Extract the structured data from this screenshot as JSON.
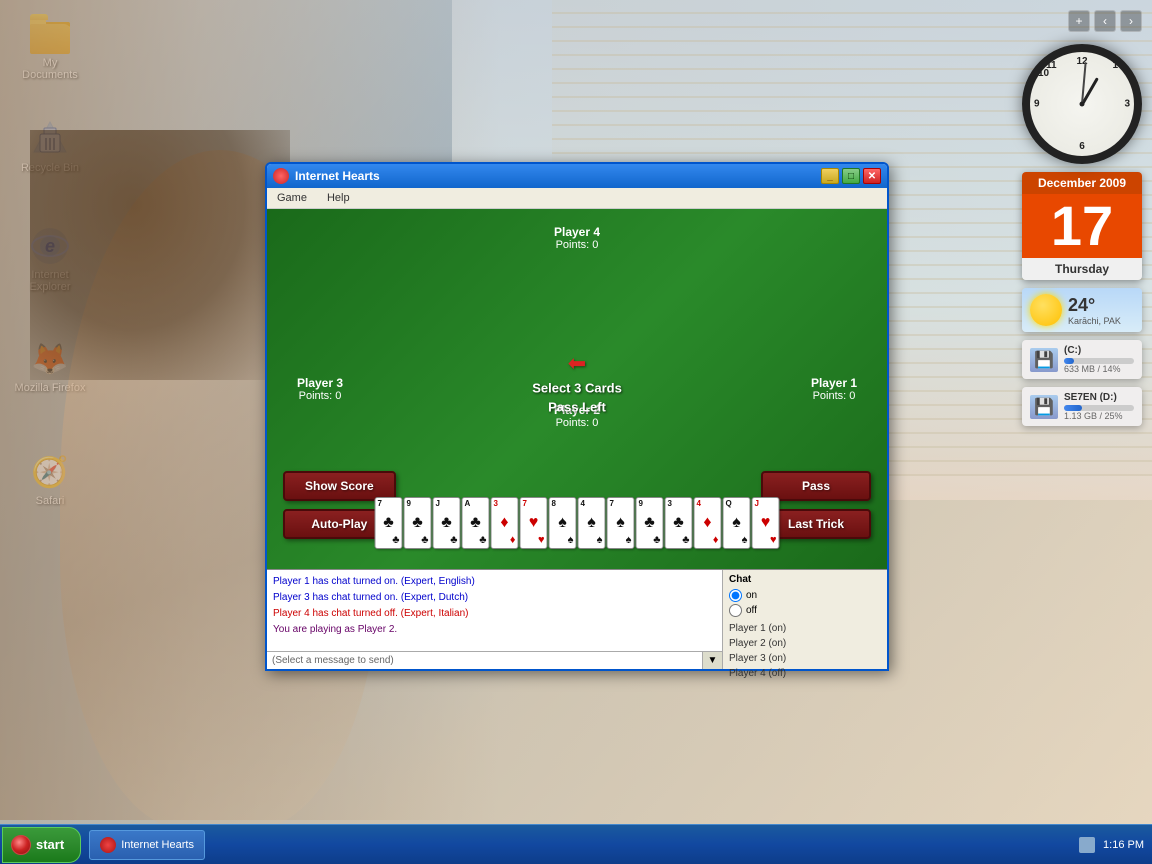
{
  "desktop": {
    "icons": [
      {
        "id": "my-documents",
        "label": "My Documents",
        "type": "folder"
      },
      {
        "id": "recycle-bin",
        "label": "Recycle Bin",
        "type": "recycle"
      },
      {
        "id": "internet-explorer",
        "label": "Internet Explorer",
        "type": "ie"
      },
      {
        "id": "mozilla-firefox",
        "label": "Mozilla Firefox",
        "type": "firefox"
      },
      {
        "id": "safari",
        "label": "Safari",
        "type": "safari"
      }
    ]
  },
  "widgets": {
    "calendar": {
      "month": "December 2009",
      "day": "17",
      "weekday": "Thursday"
    },
    "weather": {
      "temp": "24°",
      "city": "Karāchi, PAK"
    },
    "drives": [
      {
        "label": "(C:)",
        "size": "633 MB / 14%",
        "pct": 14
      },
      {
        "label": "SE7EN (D:)",
        "size": "1.13 GB / 25%",
        "pct": 25
      }
    ],
    "clock": {
      "hour_angle": 30,
      "minute_angle": 8
    }
  },
  "window": {
    "title": "Internet Hearts",
    "menu": [
      "Game",
      "Help"
    ]
  },
  "game": {
    "players": [
      {
        "id": "player4",
        "name": "Player 4",
        "points": "Points: 0"
      },
      {
        "id": "player3",
        "name": "Player 3",
        "points": "Points: 0"
      },
      {
        "id": "player1",
        "name": "Player 1",
        "points": "Points: 0"
      },
      {
        "id": "player2",
        "name": "Player 2",
        "points": "Points: 0"
      }
    ],
    "center": {
      "line1": "Select 3 Cards",
      "line2": "Pass Left"
    },
    "buttons": {
      "show_score": "Show Score",
      "auto_play": "Auto-Play",
      "pass": "Pass",
      "last_trick": "Last Trick"
    },
    "cards": [
      {
        "rank": "7",
        "suit": "♣",
        "color": "black"
      },
      {
        "rank": "9",
        "suit": "♣",
        "color": "black"
      },
      {
        "rank": "J",
        "suit": "♣",
        "color": "black"
      },
      {
        "rank": "A",
        "suit": "♣",
        "color": "black"
      },
      {
        "rank": "3",
        "suit": "♦",
        "color": "red"
      },
      {
        "rank": "7",
        "suit": "♥",
        "color": "red"
      },
      {
        "rank": "8",
        "suit": "♠",
        "color": "black"
      },
      {
        "rank": "4",
        "suit": "♠",
        "color": "black"
      },
      {
        "rank": "7",
        "suit": "♠",
        "color": "black"
      },
      {
        "rank": "9",
        "suit": "♣",
        "color": "black"
      },
      {
        "rank": "3",
        "suit": "♣",
        "color": "black"
      },
      {
        "rank": "4",
        "suit": "♦",
        "color": "red"
      },
      {
        "rank": "Q",
        "suit": "♠",
        "color": "black"
      },
      {
        "rank": "J",
        "suit": "♥",
        "color": "red"
      }
    ]
  },
  "chat": {
    "log": [
      {
        "text": "Player 1 has chat turned on.  (Expert, English)",
        "color": "blue"
      },
      {
        "text": "Player 3 has chat turned on.  (Expert, Dutch)",
        "color": "blue"
      },
      {
        "text": "Player 4 has chat turned off.  (Expert, Italian)",
        "color": "red"
      },
      {
        "text": "You are playing as Player 2.",
        "color": "purple"
      }
    ],
    "input_placeholder": "(Select a message to send)",
    "header": "Chat",
    "radio_on": "on",
    "radio_off": "off",
    "players": [
      "Player 1 (on)",
      "Player 2 (on)",
      "Player 3 (on)",
      "Player 4 (off)"
    ]
  },
  "taskbar": {
    "start_label": "start",
    "app_label": "Internet Hearts",
    "time": "1:16 PM"
  }
}
